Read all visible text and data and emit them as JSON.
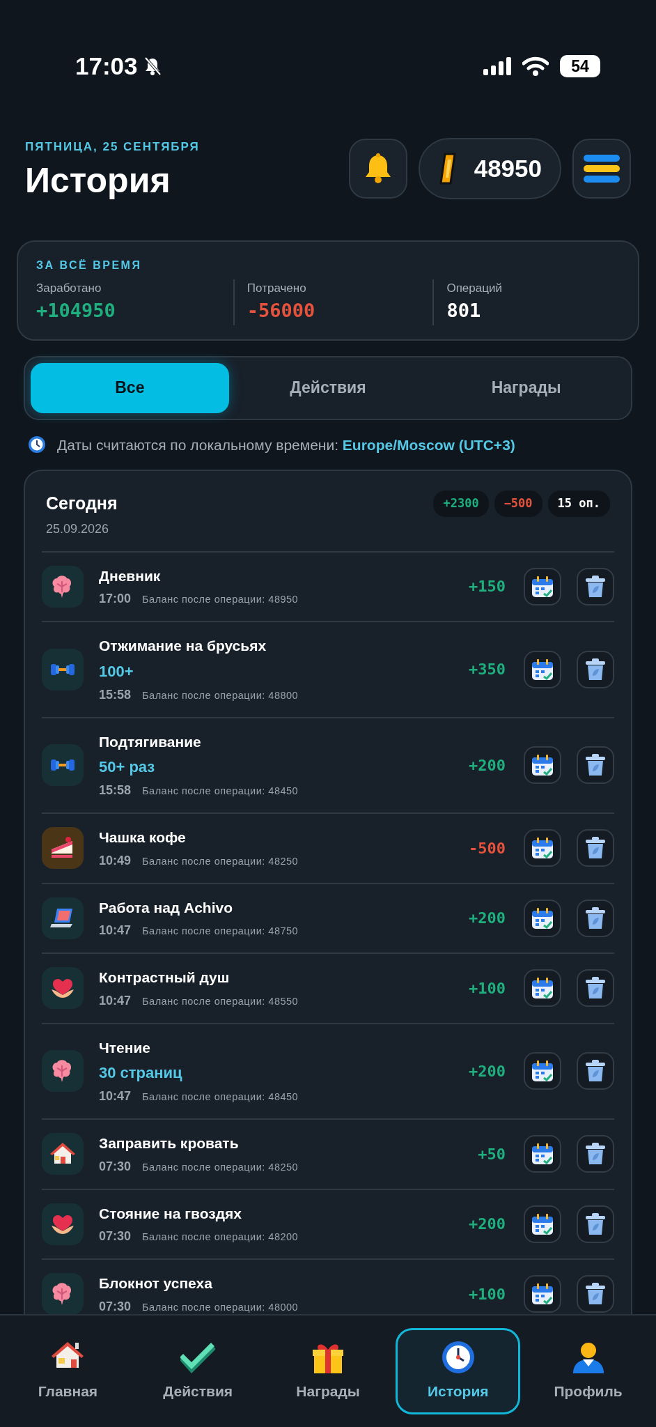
{
  "status_bar": {
    "time": "17:03",
    "battery": "54"
  },
  "header": {
    "date": "ПЯТНИЦА, 25 СЕНТЯБРЯ",
    "title": "История",
    "coins": "48950"
  },
  "summary": {
    "title": "ЗА ВСЁ ВРЕМЯ",
    "stats": [
      {
        "label": "Заработано",
        "value": "+104950",
        "color": "#1fae7d"
      },
      {
        "label": "Потрачено",
        "value": "-56000",
        "color": "#e5533c"
      },
      {
        "label": "Операций",
        "value": "801",
        "color": "#ffffff"
      }
    ]
  },
  "tabs": [
    {
      "label": "Все",
      "selected": true
    },
    {
      "label": "Действия",
      "selected": false
    },
    {
      "label": "Награды",
      "selected": false
    }
  ],
  "timezone_note": {
    "text": "Даты считаются по локальному времени:",
    "zone": "Europe/Moscow (UTC+3)"
  },
  "day": {
    "title": "Сегодня",
    "date": "25.09.2026",
    "chips": [
      {
        "text": "+2300",
        "color": "#1fae7d"
      },
      {
        "text": "−500",
        "color": "#e5533c"
      },
      {
        "text": "15 оп.",
        "color": "#ffffff"
      }
    ],
    "items": [
      {
        "kind": "mind",
        "title": "Дневник",
        "time": "17:00",
        "balance": "Баланс после операции: 48950",
        "amount": "+150",
        "color": "#1fae7d"
      },
      {
        "kind": "sport",
        "title": "Отжимание на брусьях",
        "subtitle": "100+",
        "time": "15:58",
        "balance": "Баланс после операции: 48800",
        "amount": "+350",
        "color": "#1fae7d"
      },
      {
        "kind": "sport",
        "title": "Подтягивание",
        "subtitle": "50+ раз",
        "time": "15:58",
        "balance": "Баланс после операции: 48450",
        "amount": "+200",
        "color": "#1fae7d"
      },
      {
        "kind": "treat",
        "title": "Чашка кофе",
        "time": "10:49",
        "balance": "Баланс после операции: 48250",
        "amount": "-500",
        "color": "#e5533c"
      },
      {
        "kind": "work",
        "title": "Работа над Achivo",
        "time": "10:47",
        "balance": "Баланс после операции: 48750",
        "amount": "+200",
        "color": "#1fae7d"
      },
      {
        "kind": "health",
        "title": "Контрастный душ",
        "time": "10:47",
        "balance": "Баланс после операции: 48550",
        "amount": "+100",
        "color": "#1fae7d"
      },
      {
        "kind": "mind",
        "title": "Чтение",
        "subtitle": "30 страниц",
        "time": "10:47",
        "balance": "Баланс после операции: 48450",
        "amount": "+200",
        "color": "#1fae7d"
      },
      {
        "kind": "home",
        "title": "Заправить кровать",
        "time": "07:30",
        "balance": "Баланс после операции: 48250",
        "amount": "+50",
        "color": "#1fae7d"
      },
      {
        "kind": "health",
        "title": "Стояние на гвоздях",
        "time": "07:30",
        "balance": "Баланс после операции: 48200",
        "amount": "+200",
        "color": "#1fae7d"
      },
      {
        "kind": "mind",
        "title": "Блокнот успеха",
        "time": "07:30",
        "balance": "Баланс после операции: 48000",
        "amount": "+100",
        "color": "#1fae7d"
      }
    ]
  },
  "bottom_nav": [
    {
      "kind": "home",
      "label": "Главная",
      "selected": false
    },
    {
      "kind": "check",
      "label": "Действия",
      "selected": false
    },
    {
      "kind": "gift",
      "label": "Награды",
      "selected": false
    },
    {
      "kind": "clock",
      "label": "История",
      "selected": true
    },
    {
      "kind": "person",
      "label": "Профиль",
      "selected": false
    }
  ]
}
